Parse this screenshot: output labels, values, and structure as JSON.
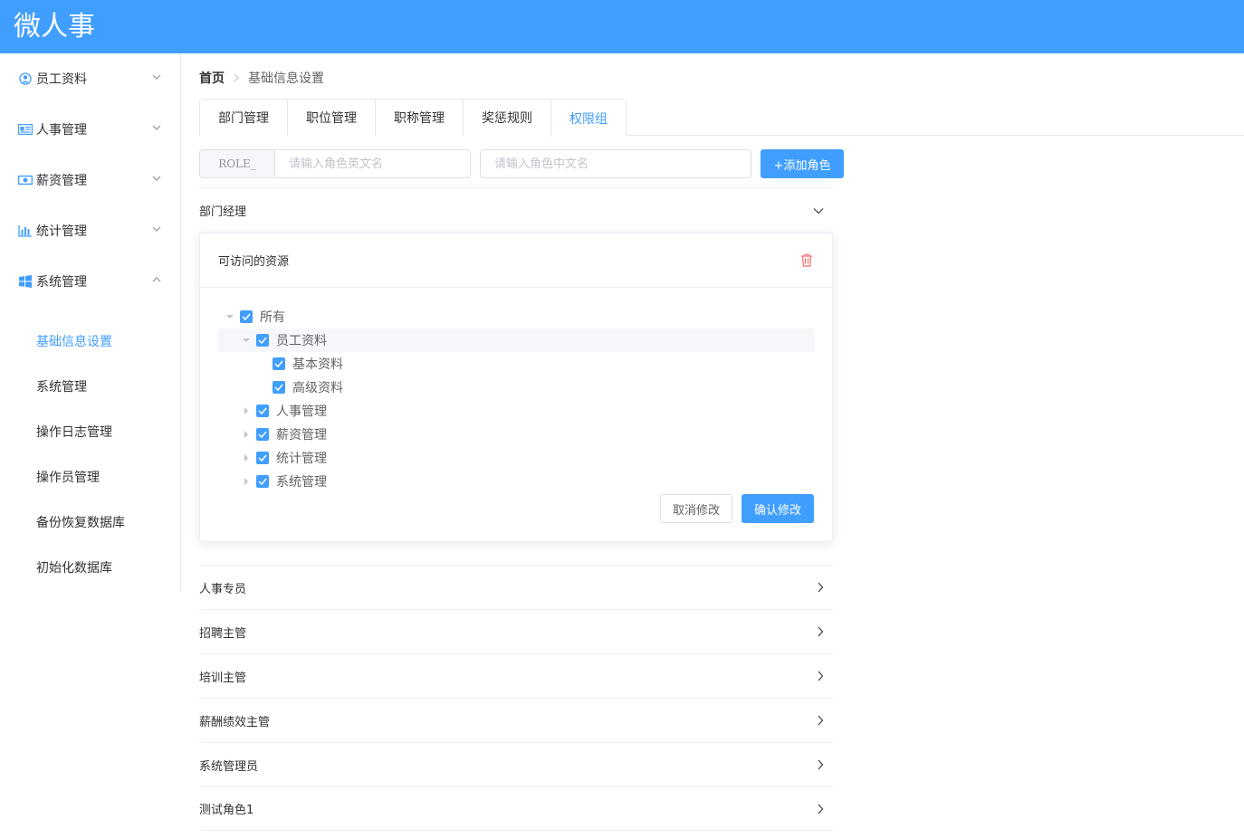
{
  "app": {
    "title": "微人事"
  },
  "sidebar": {
    "menus": [
      {
        "label": "员工资料",
        "icon": "user-circle-icon",
        "expanded": false
      },
      {
        "label": "人事管理",
        "icon": "id-card-icon",
        "expanded": false
      },
      {
        "label": "薪资管理",
        "icon": "money-icon",
        "expanded": false
      },
      {
        "label": "统计管理",
        "icon": "bar-chart-icon",
        "expanded": false
      },
      {
        "label": "系统管理",
        "icon": "windows-icon",
        "expanded": true
      }
    ],
    "submenu": [
      {
        "label": "基础信息设置",
        "active": true
      },
      {
        "label": "系统管理",
        "active": false
      },
      {
        "label": "操作日志管理",
        "active": false
      },
      {
        "label": "操作员管理",
        "active": false
      },
      {
        "label": "备份恢复数据库",
        "active": false
      },
      {
        "label": "初始化数据库",
        "active": false
      }
    ]
  },
  "breadcrumb": {
    "home": "首页",
    "current": "基础信息设置"
  },
  "tabs": [
    {
      "label": "部门管理",
      "active": false
    },
    {
      "label": "职位管理",
      "active": false
    },
    {
      "label": "职称管理",
      "active": false
    },
    {
      "label": "奖惩规则",
      "active": false
    },
    {
      "label": "权限组",
      "active": true
    }
  ],
  "role_form": {
    "prefix": "ROLE_",
    "en_placeholder": "请输入角色英文名",
    "zh_placeholder": "请输入角色中文名",
    "add_button": "+添加角色"
  },
  "expanded_role": {
    "name": "部门经理",
    "card_title": "可访问的资源",
    "tree": [
      {
        "label": "所有",
        "checked": true,
        "expanded": true
      },
      {
        "label": "员工资料",
        "checked": true,
        "expanded": true,
        "highlighted": true
      },
      {
        "label": "基本资料",
        "checked": true
      },
      {
        "label": "高级资料",
        "checked": true
      },
      {
        "label": "人事管理",
        "checked": true,
        "expanded": false
      },
      {
        "label": "薪资管理",
        "checked": true,
        "expanded": false
      },
      {
        "label": "统计管理",
        "checked": true,
        "expanded": false
      },
      {
        "label": "系统管理",
        "checked": true,
        "expanded": false
      }
    ],
    "cancel_button": "取消修改",
    "confirm_button": "确认修改"
  },
  "roles": [
    "人事专员",
    "招聘主管",
    "培训主管",
    "薪酬绩效主管",
    "系统管理员",
    "测试角色1"
  ],
  "colors": {
    "primary": "#409eff",
    "danger": "#f56c6c",
    "border": "#ebeef5"
  }
}
